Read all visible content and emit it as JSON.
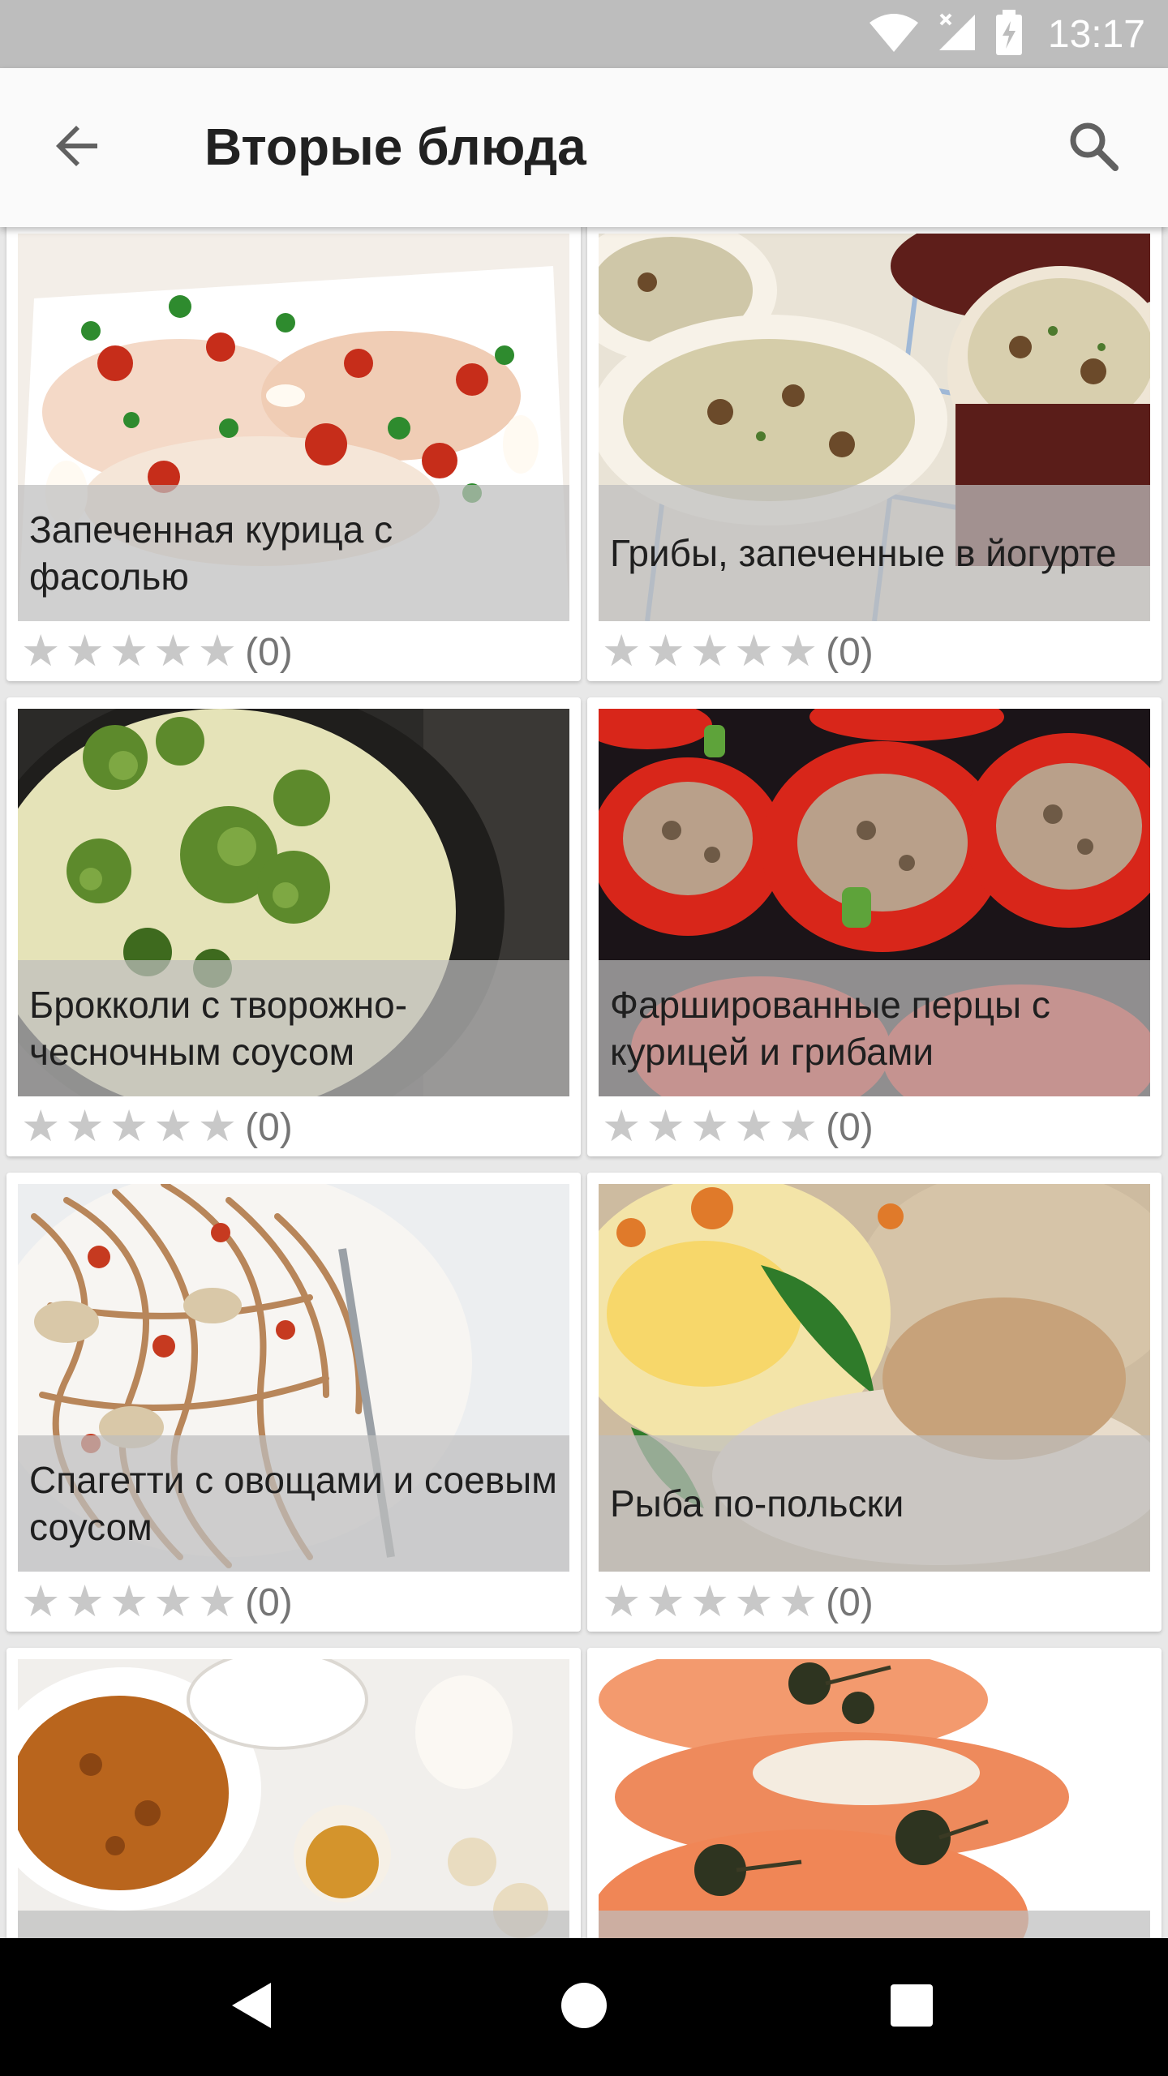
{
  "status": {
    "time": "13:17"
  },
  "app_bar": {
    "title": "Вторые блюда"
  },
  "cards": [
    {
      "title": "Запеченная курица с фасолью",
      "rating_count": "(0)"
    },
    {
      "title": "Грибы, запеченные в йогурте",
      "rating_count": "(0)"
    },
    {
      "title": "Брокколи с творожно-чесночным соусом",
      "rating_count": "(0)"
    },
    {
      "title": "Фаршированные перцы с курицей и грибами",
      "rating_count": "(0)"
    },
    {
      "title": "Спагетти с овощами и соевым соусом",
      "rating_count": "(0)"
    },
    {
      "title": "Рыба по-польски",
      "rating_count": "(0)"
    },
    {
      "title": "",
      "rating_count": ""
    },
    {
      "title": "",
      "rating_count": ""
    }
  ],
  "colors": {
    "status_bar": "#bdbdbd",
    "app_bar": "#fafafa",
    "nav_bar": "#000000",
    "star": "#c8c8c8"
  },
  "icons": {
    "back": "arrow-back-icon",
    "search": "search-icon",
    "nav": [
      "back-triangle-icon",
      "home-circle-icon",
      "recents-square-icon"
    ]
  }
}
